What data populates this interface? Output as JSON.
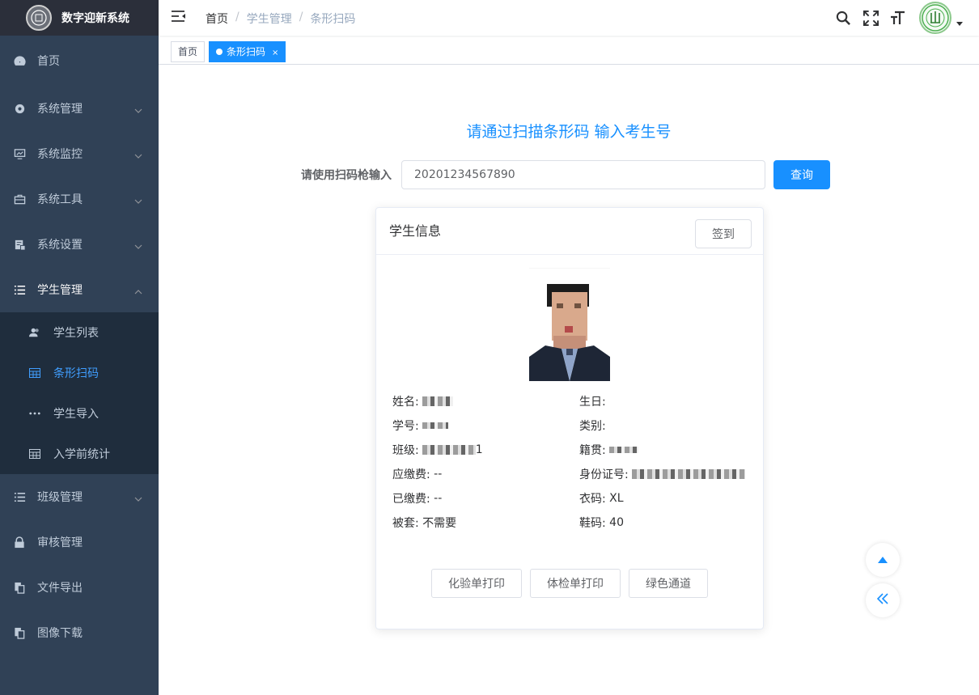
{
  "app": {
    "title": "数字迎新系统"
  },
  "sidebar": {
    "items": [
      {
        "label": "首页"
      },
      {
        "label": "系统管理"
      },
      {
        "label": "系统监控"
      },
      {
        "label": "系统工具"
      },
      {
        "label": "系统设置"
      },
      {
        "label": "学生管理"
      },
      {
        "label": "班级管理"
      },
      {
        "label": "审核管理"
      },
      {
        "label": "文件导出"
      },
      {
        "label": "图像下载"
      }
    ],
    "sub_items": [
      {
        "label": "学生列表"
      },
      {
        "label": "条形扫码"
      },
      {
        "label": "学生导入"
      },
      {
        "label": "入学前统计"
      }
    ]
  },
  "breadcrumb": [
    "首页",
    "学生管理",
    "条形扫码"
  ],
  "tags": [
    "首页",
    "条形扫码"
  ],
  "scan": {
    "title": "请通过扫描条形码 输入考生号",
    "label": "请使用扫码枪输入",
    "value": "20201234567890",
    "query_label": "查询"
  },
  "card": {
    "title": "学生信息",
    "signin_label": "签到",
    "fields": {
      "name_label": "姓名:",
      "birth_label": "生日:",
      "id_label": "学号:",
      "type_label": "类别:",
      "class_label": "班级:",
      "class_suffix": "1",
      "native_label": "籍贯:",
      "due_label": "应缴费:",
      "due_value": "--",
      "idcard_label": "身份证号:",
      "paid_label": "已缴费:",
      "paid_value": "--",
      "clothes_label": "衣码:",
      "clothes_value": "XL",
      "bedding_label": "被套:",
      "bedding_value": "不需要",
      "shoe_label": "鞋码:",
      "shoe_value": "40"
    },
    "actions": [
      "化验单打印",
      "体检单打印",
      "绿色通道"
    ]
  },
  "colors": {
    "sidebar_bg": "#304156",
    "accent": "#1890ff",
    "submenu_bg": "#1f2d3d"
  }
}
